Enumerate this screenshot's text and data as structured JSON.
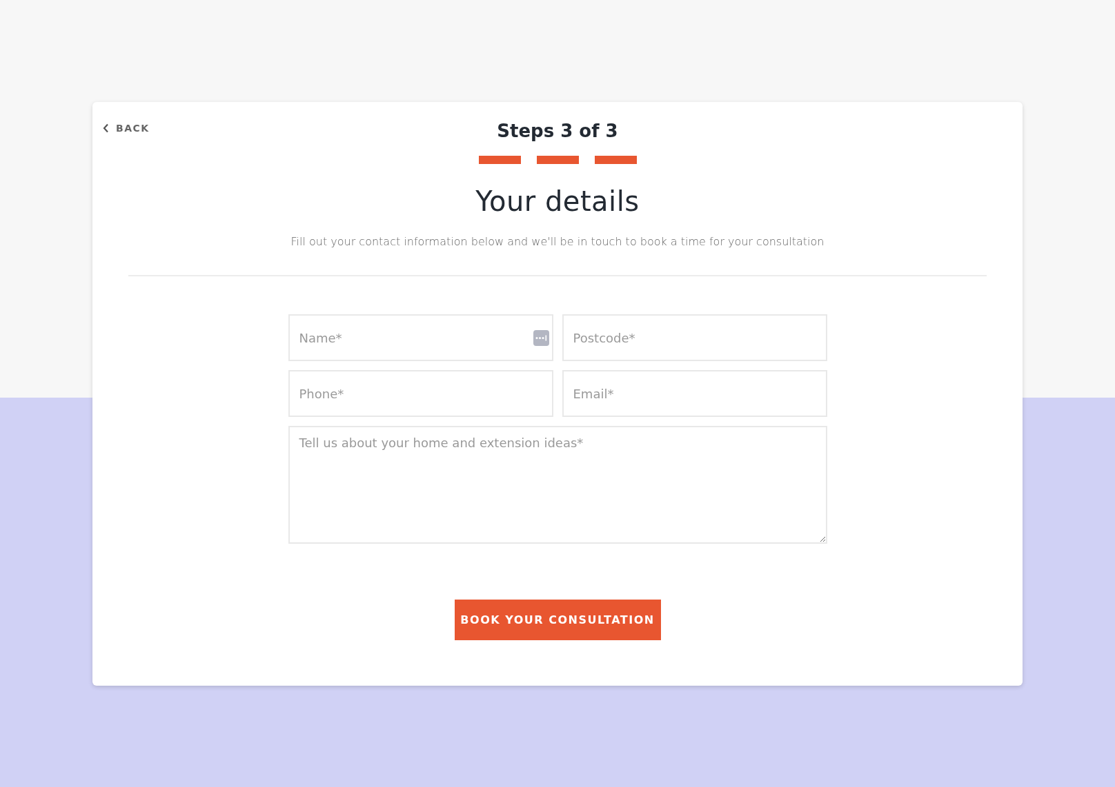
{
  "back_link": {
    "label": "BACK"
  },
  "step_title": "Steps 3 of 3",
  "steps": [
    {
      "completed": true
    },
    {
      "completed": true
    },
    {
      "completed": true
    }
  ],
  "heading": "Your details",
  "intro": "Fill out your contact information below and we'll be in touch to book a time for your consultation",
  "fields": [
    {
      "placeholder": "Name*",
      "autofill_icon": true
    },
    {
      "placeholder": "Postcode*",
      "autofill_icon": false
    },
    {
      "placeholder": "Phone*",
      "autofill_icon": false
    },
    {
      "placeholder": "Email*",
      "autofill_icon": false
    }
  ],
  "message": {
    "placeholder": "Tell us about your home and extension ideas*"
  },
  "submit_button": "BOOK YOUR CONSULTATION"
}
